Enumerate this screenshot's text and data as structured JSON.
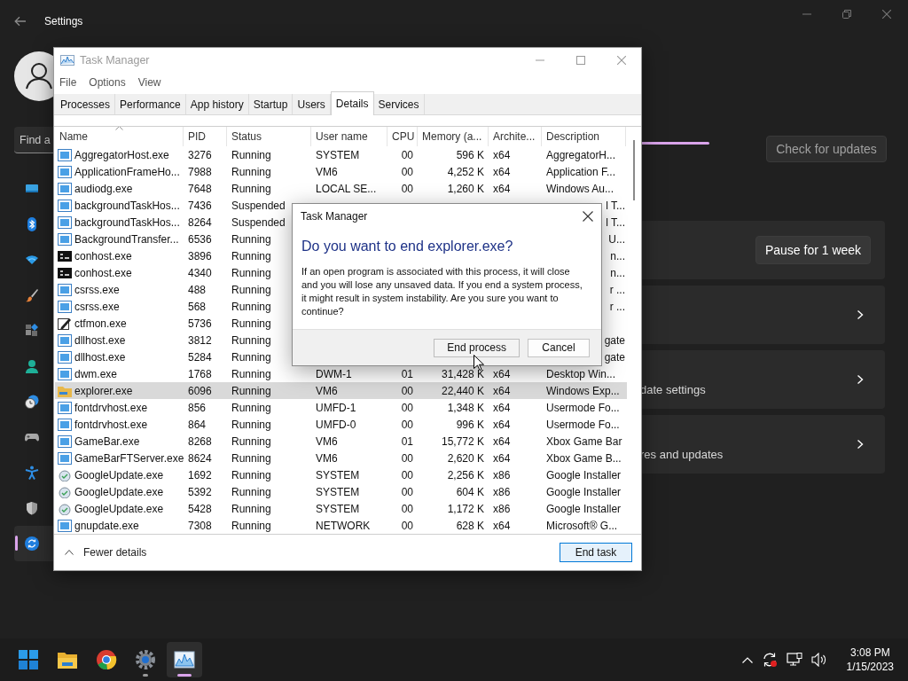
{
  "settings": {
    "title": "Settings",
    "search": {
      "placeholder": "Find a"
    },
    "sidebar": {
      "items": [
        {
          "selected": false
        },
        {
          "selected": false
        },
        {
          "selected": false
        },
        {
          "selected": false
        },
        {
          "selected": false
        },
        {
          "selected": false
        },
        {
          "selected": false
        },
        {
          "selected": false
        },
        {
          "selected": false
        },
        {
          "selected": false
        },
        {
          "selected": true
        }
      ]
    },
    "check_button": {
      "label": "Check for updates",
      "disabled": true
    },
    "cards": [
      {
        "kind": "button",
        "button": "Pause for 1 week"
      },
      {
        "kind": "link"
      },
      {
        "kind": "link",
        "text": "date settings"
      },
      {
        "kind": "link",
        "text": "res and updates"
      }
    ]
  },
  "task_manager": {
    "title": "Task Manager",
    "menu": [
      "File",
      "Options",
      "View"
    ],
    "tabs": [
      {
        "label": "Processes",
        "selected": false
      },
      {
        "label": "Performance",
        "selected": false
      },
      {
        "label": "App history",
        "selected": false
      },
      {
        "label": "Startup",
        "selected": false
      },
      {
        "label": "Users",
        "selected": false
      },
      {
        "label": "Details",
        "selected": true
      },
      {
        "label": "Services",
        "selected": false
      }
    ],
    "table": {
      "columns": [
        {
          "label": "Name",
          "sorted": true
        },
        {
          "label": "PID",
          "sorted": false
        },
        {
          "label": "Status",
          "sorted": false
        },
        {
          "label": "User name",
          "sorted": false
        },
        {
          "label": "CPU",
          "sorted": false
        },
        {
          "label": "Memory (a...",
          "sorted": false
        },
        {
          "label": "Archite...",
          "sorted": false
        },
        {
          "label": "Description",
          "sorted": false
        }
      ],
      "rows": [
        {
          "kind": "window",
          "name": "AggregatorHost.exe",
          "pid": "3276",
          "status": "Running",
          "user": "SYSTEM",
          "cpu": "00",
          "memory": "596 K",
          "arch": "x64",
          "description": "AggregatorH...",
          "selected": false
        },
        {
          "kind": "window",
          "name": "ApplicationFrameHo...",
          "pid": "7988",
          "status": "Running",
          "user": "VM6",
          "cpu": "00",
          "memory": "4,252 K",
          "arch": "x64",
          "description": "Application F...",
          "selected": false
        },
        {
          "kind": "window",
          "name": "audiodg.exe",
          "pid": "7648",
          "status": "Running",
          "user": "LOCAL SE...",
          "cpu": "00",
          "memory": "1,260 K",
          "arch": "x64",
          "description": "Windows Au...",
          "selected": false
        },
        {
          "kind": "window",
          "name": "backgroundTaskHos...",
          "pid": "7436",
          "status": "Suspended",
          "description": "l T...",
          "selected": false
        },
        {
          "kind": "window",
          "name": "backgroundTaskHos...",
          "pid": "8264",
          "status": "Suspended",
          "description": "l T...",
          "selected": false
        },
        {
          "kind": "window",
          "name": "BackgroundTransfer...",
          "pid": "6536",
          "status": "Running",
          "description": "U...",
          "selected": false
        },
        {
          "kind": "console",
          "name": "conhost.exe",
          "pid": "3896",
          "status": "Running",
          "description": "n...",
          "selected": false
        },
        {
          "kind": "console",
          "name": "conhost.exe",
          "pid": "4340",
          "status": "Running",
          "description": "n...",
          "selected": false
        },
        {
          "kind": "window",
          "name": "csrss.exe",
          "pid": "488",
          "status": "Running",
          "description": "r ...",
          "selected": false
        },
        {
          "kind": "window",
          "name": "csrss.exe",
          "pid": "568",
          "status": "Running",
          "description": "r ...",
          "selected": false
        },
        {
          "kind": "pen",
          "name": "ctfmon.exe",
          "pid": "5736",
          "status": "Running",
          "selected": false
        },
        {
          "kind": "window",
          "name": "dllhost.exe",
          "pid": "3812",
          "status": "Running",
          "description": "gate",
          "selected": false
        },
        {
          "kind": "window",
          "name": "dllhost.exe",
          "pid": "5284",
          "status": "Running",
          "description": "gate",
          "selected": false
        },
        {
          "kind": "window",
          "name": "dwm.exe",
          "pid": "1768",
          "status": "Running",
          "user": "DWM-1",
          "cpu": "01",
          "memory": "31,428 K",
          "arch": "x64",
          "description": "Desktop Win...",
          "selected": false
        },
        {
          "kind": "folder",
          "name": "explorer.exe",
          "pid": "6096",
          "status": "Running",
          "user": "VM6",
          "cpu": "00",
          "memory": "22,440 K",
          "arch": "x64",
          "description": "Windows Exp...",
          "selected": true
        },
        {
          "kind": "window",
          "name": "fontdrvhost.exe",
          "pid": "856",
          "status": "Running",
          "user": "UMFD-1",
          "cpu": "00",
          "memory": "1,348 K",
          "arch": "x64",
          "description": "Usermode Fo...",
          "selected": false
        },
        {
          "kind": "window",
          "name": "fontdrvhost.exe",
          "pid": "864",
          "status": "Running",
          "user": "UMFD-0",
          "cpu": "00",
          "memory": "996 K",
          "arch": "x64",
          "description": "Usermode Fo...",
          "selected": false
        },
        {
          "kind": "window",
          "name": "GameBar.exe",
          "pid": "8268",
          "status": "Running",
          "user": "VM6",
          "cpu": "01",
          "memory": "15,772 K",
          "arch": "x64",
          "description": "Xbox Game Bar",
          "selected": false
        },
        {
          "kind": "window",
          "name": "GameBarFTServer.exe",
          "pid": "8624",
          "status": "Running",
          "user": "VM6",
          "cpu": "00",
          "memory": "2,620 K",
          "arch": "x64",
          "description": "Xbox Game B...",
          "selected": false
        },
        {
          "kind": "installer",
          "name": "GoogleUpdate.exe",
          "pid": "1692",
          "status": "Running",
          "user": "SYSTEM",
          "cpu": "00",
          "memory": "2,256 K",
          "arch": "x86",
          "description": "Google Installer",
          "selected": false
        },
        {
          "kind": "installer",
          "name": "GoogleUpdate.exe",
          "pid": "5392",
          "status": "Running",
          "user": "SYSTEM",
          "cpu": "00",
          "memory": "604 K",
          "arch": "x86",
          "description": "Google Installer",
          "selected": false
        },
        {
          "kind": "installer",
          "name": "GoogleUpdate.exe",
          "pid": "5428",
          "status": "Running",
          "user": "SYSTEM",
          "cpu": "00",
          "memory": "1,172 K",
          "arch": "x86",
          "description": "Google Installer",
          "selected": false
        },
        {
          "kind": "window",
          "name": "gnupdate.exe",
          "pid": "7308",
          "status": "Running",
          "user": "NETWORK",
          "cpu": "00",
          "memory": "628 K",
          "arch": "x64",
          "description": "Microsoft® G...",
          "selected": false
        }
      ]
    },
    "footer": {
      "toggle": "Fewer details",
      "button": "End task"
    }
  },
  "dialog": {
    "title": "Task Manager",
    "heading": "Do you want to end explorer.exe?",
    "message": "If an open program is associated with this process, it will close and you will lose any unsaved data. If you end a system process, it might result in system instability. Are you sure you want to continue?",
    "buttons": [
      {
        "label": "End process"
      },
      {
        "label": "Cancel"
      }
    ]
  },
  "taskbar": {
    "apps": [
      {
        "running": false,
        "active": false
      },
      {
        "running": false,
        "active": false
      },
      {
        "running": false,
        "active": false
      },
      {
        "running": true,
        "active": false
      },
      {
        "running": true,
        "active": true
      }
    ],
    "time": "3:08 PM",
    "date": "1/15/2023"
  }
}
